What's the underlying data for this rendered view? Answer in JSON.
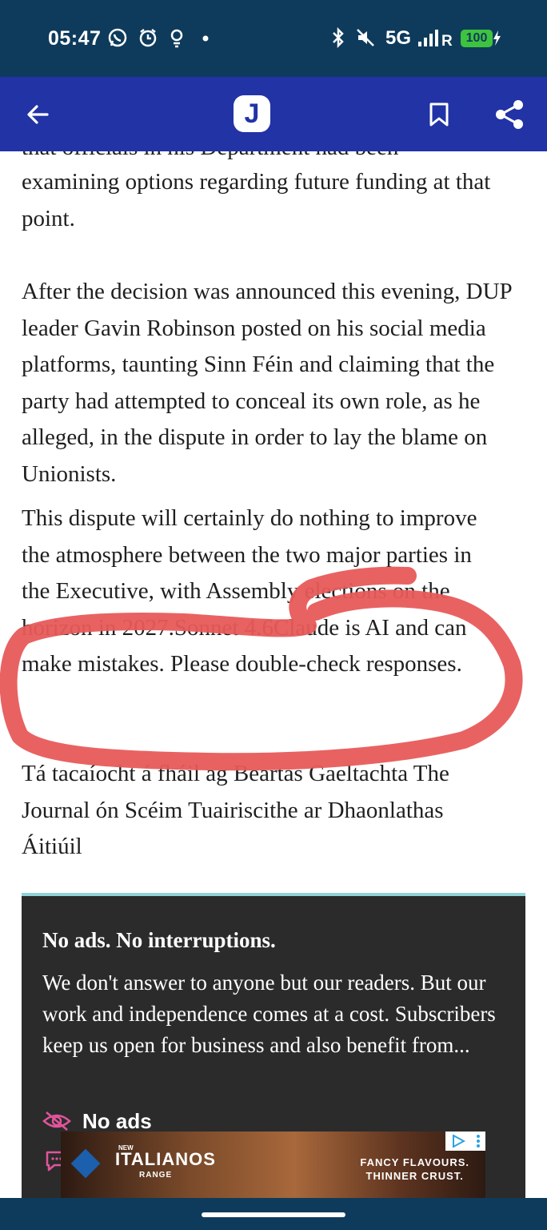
{
  "status_bar": {
    "time": "05:47",
    "network": "5G",
    "battery": "100"
  },
  "app_bar": {
    "logo_letter": "J"
  },
  "article": {
    "clipped_top_line": "that officials in his Department had been",
    "para1": "examining options regarding future funding at that point.",
    "para2": "After the decision was announced this evening, DUP leader Gavin Robinson posted on his social media platforms, taunting Sinn Féin and claiming that the party had attempted to conceal its own role, as he alleged, in the dispute in order to lay the blame on Unionists.",
    "para3": "This dispute will certainly do nothing to improve the atmosphere between the two major parties in the Executive, with Assembly elections on the horizon in 2027.Sonnet 4.6Claude is AI and can make mistakes. Please double-check responses.",
    "para4": "Tá tacaíocht á fháil ag Beartas Gaeltachta The Journal ón Scéim Tuairiscithe ar Dhaonlathas Áitiúil"
  },
  "promo_card": {
    "title": "No ads. No interruptions.",
    "body": "We don't answer to anyone but our readers. But our work and independence comes at a cost. Subscribers keep us open for business and also benefit from...",
    "perk1": "No ads"
  },
  "ad": {
    "small_label": "NEW",
    "title": "ITALIANOS",
    "subtitle": "RANGE",
    "tagline_1": "FANCY FLAVOURS.",
    "tagline_2": "THINNER CRUST."
  },
  "colors": {
    "status_bar": "#0e3b5c",
    "app_bar": "#2233a6",
    "annotation": "#e85a5a",
    "card_bg": "#2b2b2b",
    "card_accent": "#8fd3d9",
    "perk_icon": "#e0559a"
  }
}
